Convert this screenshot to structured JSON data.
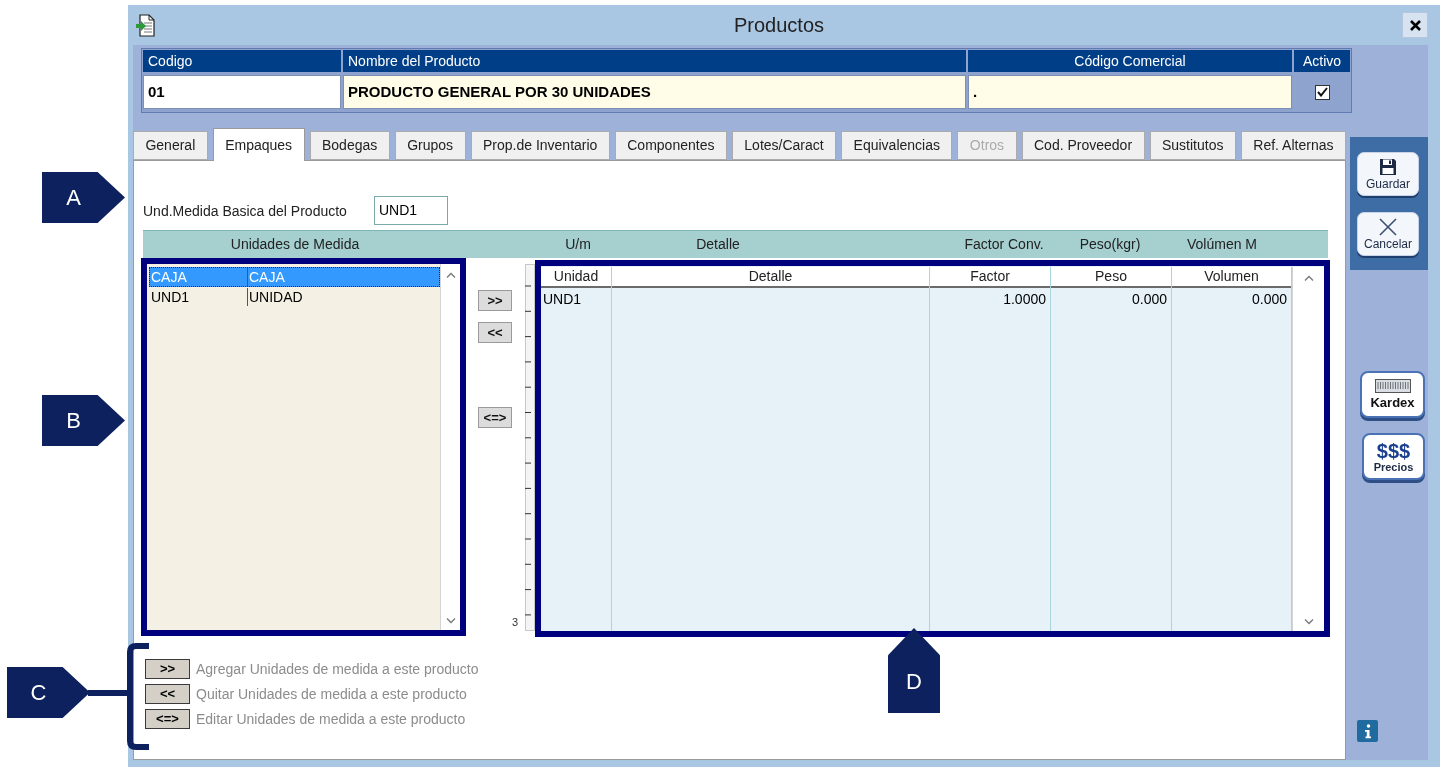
{
  "window": {
    "title": "Productos"
  },
  "product_header": {
    "columns": [
      "Codigo",
      "Nombre del Producto",
      "Código Comercial",
      "Activo"
    ],
    "codigo": "01",
    "nombre": "PRODUCTO GENERAL POR 30 UNIDADES",
    "codigo_comercial": ".",
    "activo": true
  },
  "tabs": [
    {
      "label": "General",
      "selected": false,
      "disabled": false
    },
    {
      "label": "Empaques",
      "selected": true,
      "disabled": false
    },
    {
      "label": "Bodegas",
      "selected": false,
      "disabled": false
    },
    {
      "label": "Grupos",
      "selected": false,
      "disabled": false
    },
    {
      "label": "Prop.de Inventario",
      "selected": false,
      "disabled": false
    },
    {
      "label": "Componentes",
      "selected": false,
      "disabled": false
    },
    {
      "label": "Lotes/Caract",
      "selected": false,
      "disabled": false
    },
    {
      "label": "Equivalencias",
      "selected": false,
      "disabled": false
    },
    {
      "label": "Otros",
      "selected": false,
      "disabled": true
    },
    {
      "label": "Cod. Proveedor",
      "selected": false,
      "disabled": false
    },
    {
      "label": "Sustitutos",
      "selected": false,
      "disabled": false
    },
    {
      "label": "Ref. Alternas",
      "selected": false,
      "disabled": false
    }
  ],
  "basic_unit": {
    "label": "Und.Medida Basica del Producto",
    "value": "UND1"
  },
  "units_bar": [
    "Unidades de Medida",
    "U/m",
    "Detalle",
    "Factor Conv.",
    "Peso(kgr)",
    "Volúmen M"
  ],
  "units_list": {
    "rows": [
      {
        "code": "CAJA",
        "name": "CAJA",
        "selected": true
      },
      {
        "code": "UND1",
        "name": "UNIDAD",
        "selected": false
      }
    ]
  },
  "move_buttons": [
    {
      "kind": "add",
      "label": ">>"
    },
    {
      "kind": "remove",
      "label": "<<"
    },
    {
      "kind": "edit",
      "label": "<=>"
    }
  ],
  "row_count": "3",
  "product_units": {
    "columns": [
      "Unidad",
      "Detalle",
      "Factor",
      "Peso",
      "Volumen"
    ],
    "rows": [
      {
        "unidad": "UND1",
        "factor": "1.0000",
        "peso": "0.000",
        "volumen": "0.000"
      }
    ]
  },
  "legend": [
    {
      "key": ">>",
      "text": "Agregar Unidades de medida a este producto"
    },
    {
      "key": "<<",
      "text": "Quitar Unidades de medida a este producto"
    },
    {
      "key": "<=>",
      "text": "Editar Unidades de medida a este producto"
    }
  ],
  "side_buttons": [
    {
      "kind": "save",
      "label": "Guardar"
    },
    {
      "kind": "cancel",
      "label": "Cancelar"
    },
    {
      "kind": "kardex",
      "label": "Kardex"
    },
    {
      "kind": "prices",
      "glyph": "$$$",
      "label": "Precios"
    }
  ],
  "callouts": [
    {
      "label": "A",
      "kind": "right"
    },
    {
      "label": "B",
      "kind": "right"
    },
    {
      "label": "C",
      "kind": "bracket"
    },
    {
      "label": "D",
      "kind": "up"
    }
  ]
}
